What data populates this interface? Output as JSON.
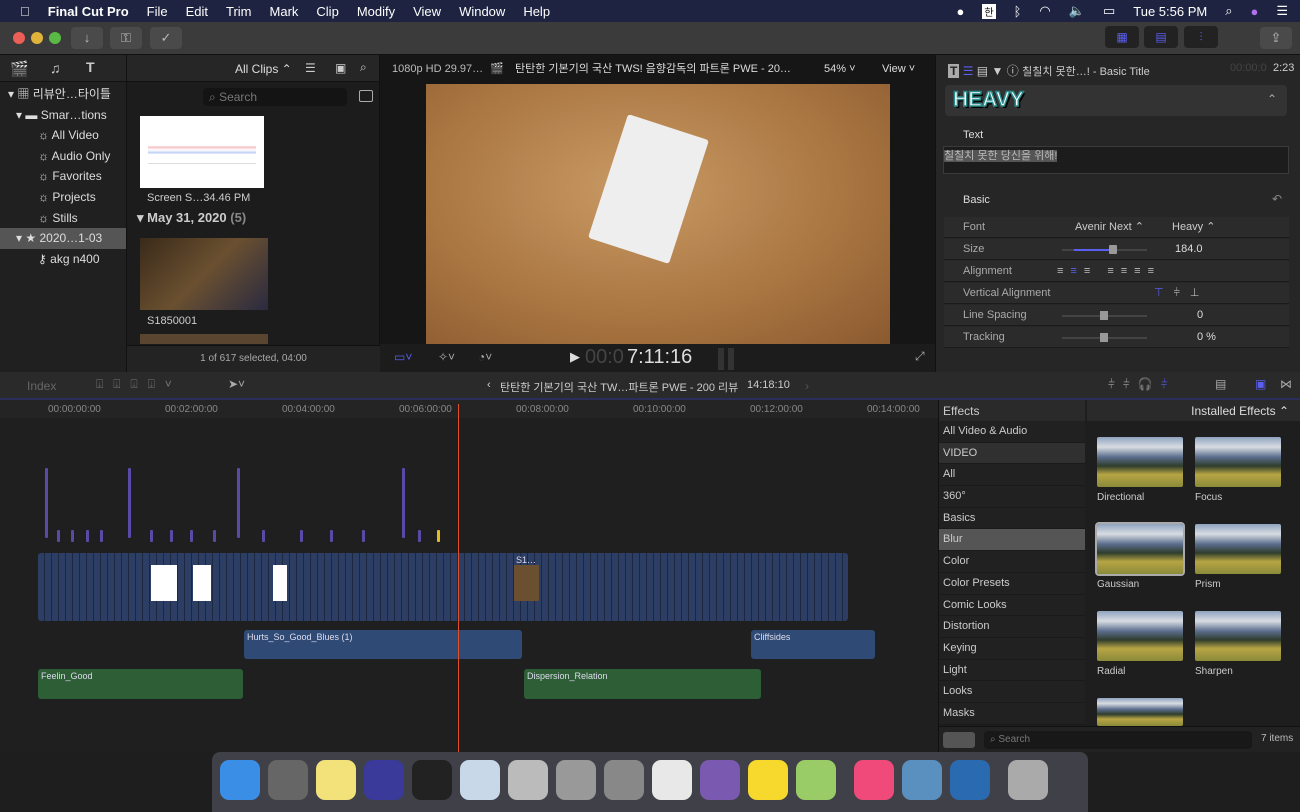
{
  "menubar": {
    "app": "Final Cut Pro",
    "items": [
      "File",
      "Edit",
      "Trim",
      "Mark",
      "Clip",
      "Modify",
      "View",
      "Window",
      "Help"
    ],
    "clock": "Tue 5:56 PM",
    "input_method": "한"
  },
  "libraries": {
    "items": [
      {
        "label": "리뷰안…타이틀"
      },
      {
        "label": "Smar…tions"
      },
      {
        "label": "All Video"
      },
      {
        "label": "Audio Only"
      },
      {
        "label": "Favorites"
      },
      {
        "label": "Projects"
      },
      {
        "label": "Stills"
      },
      {
        "label": "2020…1-03"
      },
      {
        "label": "akg n400"
      }
    ]
  },
  "browser": {
    "filter": "All Clips",
    "search_placeholder": "Search",
    "clip1": "Screen S…34.46 PM",
    "group_date": "May 31, 2020",
    "group_count": "(5)",
    "clip2": "S1850001",
    "status": "1 of 617 selected, 04:00"
  },
  "viewer": {
    "format": "1080p HD 29.97…",
    "title": "탄탄한 기본기의 국산 TWS! 음향감독의 파트론 PWE - 20…",
    "zoom": "54%",
    "view": "View",
    "timecode_dim": "00:0",
    "timecode": "7:11:16"
  },
  "inspector": {
    "title": "칠칠치 못한…! - Basic Title",
    "timecode_dim": "00:00:0",
    "timecode": "2:23",
    "preset": "HEAVY",
    "text_label": "Text",
    "text_value": "칠칠치 못한 당신을 위해!",
    "basic_label": "Basic",
    "font_label": "Font",
    "font_value": "Avenir Next",
    "weight_value": "Heavy",
    "size_label": "Size",
    "size_value": "184.0",
    "size_fraction": 0.6,
    "alignment_label": "Alignment",
    "valign_label": "Vertical Alignment",
    "linespacing_label": "Line Spacing",
    "linespacing_value": "0",
    "tracking_label": "Tracking",
    "tracking_value": "0 %"
  },
  "timeline": {
    "index": "Index",
    "project": "탄탄한 기본기의 국산 TW…파트론 PWE - 200 리뷰",
    "duration": "14:18:10",
    "ruler": [
      "00:00:00:00",
      "00:02:00:00",
      "00:04:00:00",
      "00:06:00:00",
      "00:08:00:00",
      "00:10:00:00",
      "00:12:00:00",
      "00:14:00:00"
    ],
    "clips": {
      "audio1": "Hurts_So_Good_Blues (1)",
      "audio2": "Cliffsides",
      "music1": "Feelin_Good",
      "music2": "Dispersion_Relation",
      "video_s1": "S1…"
    }
  },
  "effects": {
    "header": "Effects",
    "source": "Installed Effects",
    "categories": [
      "All Video & Audio",
      "VIDEO",
      "All",
      "360°",
      "Basics",
      "Blur",
      "Color",
      "Color Presets",
      "Comic Looks",
      "Distortion",
      "Keying",
      "Light",
      "Looks",
      "Masks"
    ],
    "selected_category": "Blur",
    "items": [
      "Directional",
      "Focus",
      "Gaussian",
      "Prism",
      "Radial",
      "Sharpen"
    ],
    "search_placeholder": "Search",
    "count": "7 items"
  },
  "colors": {
    "accent": "#5a5ff0",
    "playhead": "#e0502a",
    "video_clip": "#2c3e63",
    "audio_clip": "#2f4a75",
    "music_clip": "#2e5e35"
  }
}
